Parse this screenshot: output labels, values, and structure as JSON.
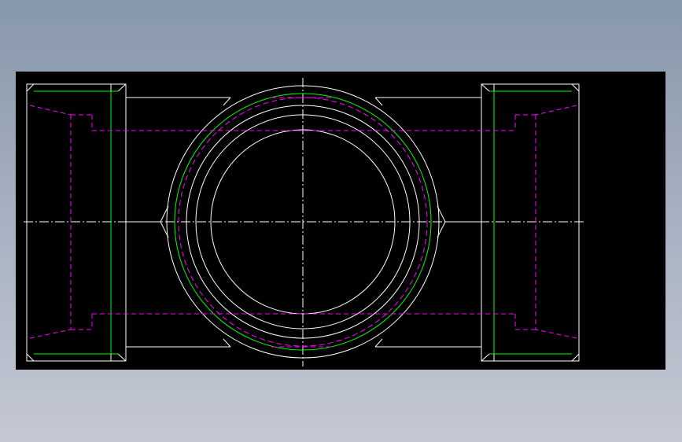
{
  "drawing": {
    "colors": {
      "background": "#000000",
      "outline": "#ffffff",
      "thread": "#00ff00",
      "hidden": "#ff00ff",
      "centerline": "#ffffff"
    },
    "view": "pipe-tee-top-view"
  }
}
